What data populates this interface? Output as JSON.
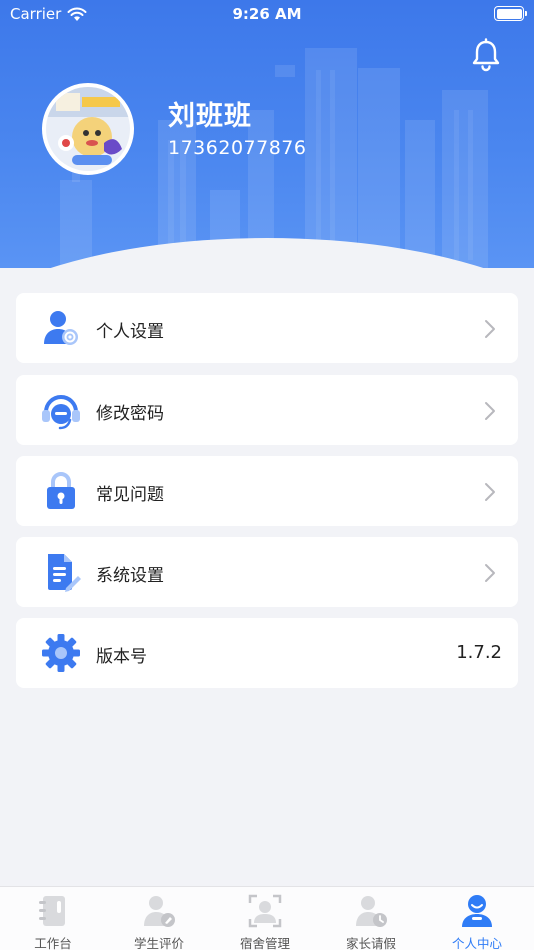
{
  "status_bar": {
    "carrier": "Carrier",
    "time": "9:26 AM"
  },
  "profile": {
    "name": "刘班班",
    "phone": "17362077876"
  },
  "menu": [
    {
      "label": "个人设置",
      "icon": "user-settings-icon"
    },
    {
      "label": "修改密码",
      "icon": "headset-icon"
    },
    {
      "label": "常见问题",
      "icon": "lock-icon"
    },
    {
      "label": "系统设置",
      "icon": "document-edit-icon"
    },
    {
      "label": "版本号",
      "icon": "gear-icon",
      "value": "1.7.2"
    }
  ],
  "tabs": [
    {
      "label": "工作台",
      "icon": "notebook-icon",
      "active": false
    },
    {
      "label": "学生评价",
      "icon": "student-evaluation-icon",
      "active": false
    },
    {
      "label": "宿舍管理",
      "icon": "face-scan-icon",
      "active": false
    },
    {
      "label": "家长请假",
      "icon": "parent-leave-icon",
      "active": false
    },
    {
      "label": "个人中心",
      "icon": "personal-center-icon",
      "active": true
    }
  ],
  "colors": {
    "primary": "#2f7cf6",
    "header": "#4a86ef",
    "background": "#f2f3f7"
  }
}
